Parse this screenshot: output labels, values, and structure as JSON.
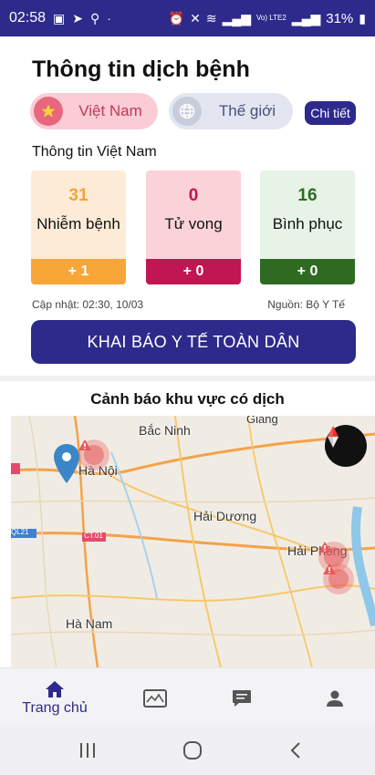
{
  "status_bar": {
    "time": "02:58",
    "battery": "31%",
    "network_label": "Vo) LTE2"
  },
  "header": {
    "title": "Thông tin dịch bệnh"
  },
  "segments": {
    "vietnam_label": "Việt Nam",
    "world_label": "Thế giới",
    "detail_label": "Chi tiết",
    "selected": "Việt Nam"
  },
  "section_title": "Thông tin Việt Nam",
  "stats": [
    {
      "value": "31",
      "label": "Nhiễm bệnh",
      "delta": "+ 1",
      "color": "#f7a637"
    },
    {
      "value": "0",
      "label": "Tử vong",
      "delta": "+ 0",
      "color": "#c01651"
    },
    {
      "value": "16",
      "label": "Bình phục",
      "delta": "+ 0",
      "color": "#2e6b21"
    }
  ],
  "update_text": "Cập nhật: 02:30, 10/03",
  "source_text": "Nguồn: Bộ Y Tế",
  "cta_label": "KHAI BÁO Y TẾ TOÀN DÂN",
  "map": {
    "title": "Cảnh báo khu vực có dịch",
    "cities": [
      "Bắc Ninh",
      "Hà Nội",
      "Hải Dương",
      "Hải Phòng",
      "Hà Nam",
      "Giang"
    ],
    "road_labels": [
      "QL21",
      "CT.01"
    ]
  },
  "bottom_nav": {
    "items": [
      {
        "label": "Trang chủ",
        "icon": "home-icon",
        "active": true
      },
      {
        "label": "",
        "icon": "news-icon",
        "active": false
      },
      {
        "label": "",
        "icon": "chat-icon",
        "active": false
      },
      {
        "label": "",
        "icon": "profile-icon",
        "active": false
      }
    ]
  },
  "colors": {
    "primary": "#2d2a8c",
    "infected": "#f7a637",
    "deaths": "#c01651",
    "recovered": "#2e6b21"
  }
}
